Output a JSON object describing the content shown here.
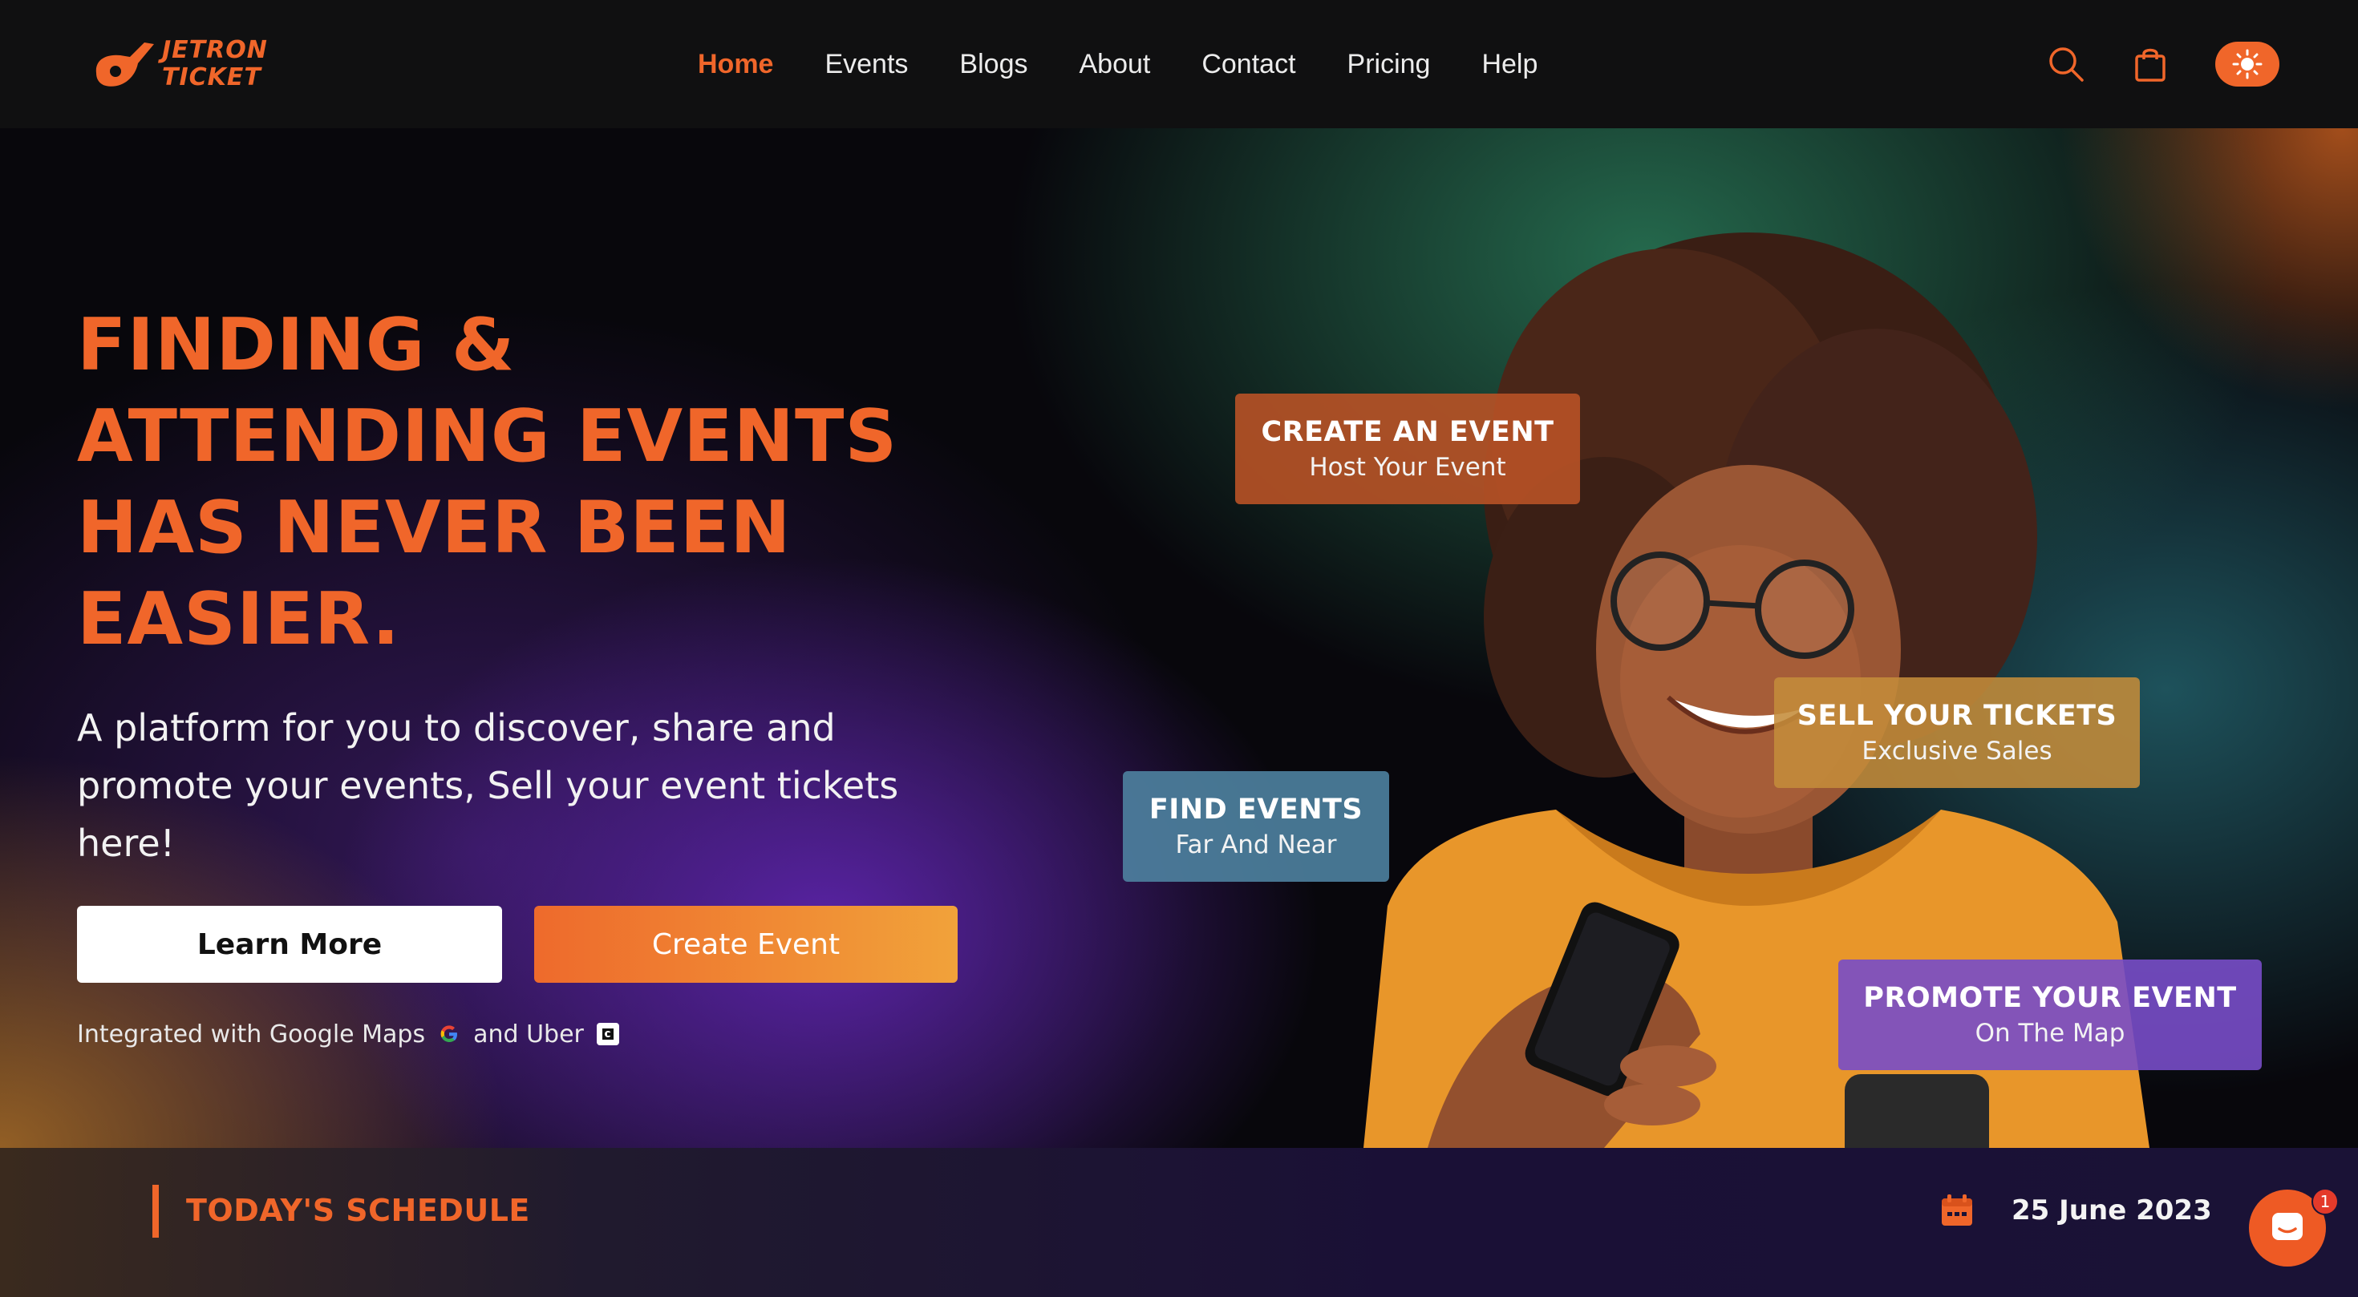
{
  "brand": {
    "line1": "JETRON",
    "line2": "TICKET",
    "accent": "#f0662a"
  },
  "nav": {
    "links": [
      "Home",
      "Events",
      "Blogs",
      "About",
      "Contact",
      "Pricing",
      "Help"
    ],
    "active": "Home",
    "icons": {
      "search": "search-icon",
      "cart": "shopping-bag-icon",
      "theme": "sun-icon"
    }
  },
  "hero": {
    "headline_lines": [
      "FINDING &",
      "ATTENDING EVENTS",
      "HAS NEVER BEEN",
      "EASIER."
    ],
    "subtext_lines": [
      "A platform for you to discover, share and",
      "promote your events, Sell your event tickets",
      "here!"
    ],
    "learn_more": "Learn More",
    "create_event": "Create Event",
    "integrated_prefix": "Integrated with Google Maps",
    "integrated_and": "and Uber",
    "cards": {
      "create": {
        "title": "CREATE AN EVENT",
        "sub": "Host Your Event"
      },
      "sell": {
        "title": "SELL YOUR TICKETS",
        "sub": "Exclusive Sales"
      },
      "find": {
        "title": "FIND EVENTS",
        "sub": "Far And Near"
      },
      "promote": {
        "title": "PROMOTE YOUR EVENT",
        "sub": "On The Map"
      }
    }
  },
  "schedule": {
    "title": "TODAY'S SCHEDULE",
    "date": "25 June 2023",
    "chat_badge": "1"
  }
}
